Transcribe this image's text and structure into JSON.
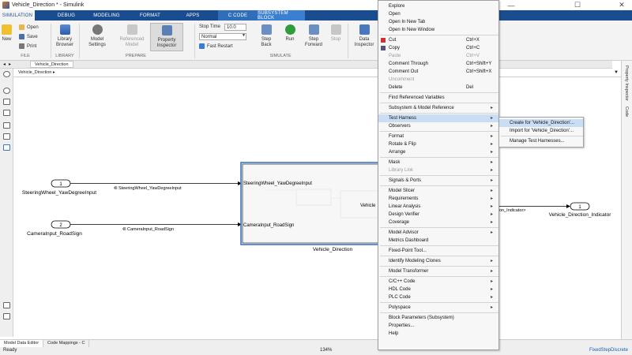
{
  "window": {
    "title": "Vehicle_Direction * - Simulink",
    "minimize": "—",
    "maximize": "☐",
    "close": "✕"
  },
  "tabs": [
    "SIMULATION",
    "DEBUG",
    "MODELING",
    "FORMAT",
    "APPS",
    "C CODE",
    "SUBSYSTEM BLOCK"
  ],
  "ribbon": {
    "new": "New",
    "open": "Open",
    "save": "Save",
    "print": "Print",
    "library_browser": "Library\nBrowser",
    "model_settings": "Model\nSettings",
    "referenced_model": "Referenced\nModel",
    "property_inspector": "Property\nInspector",
    "stop_time_label": "Stop Time",
    "stop_time_value": "10.0",
    "mode_value": "Normal",
    "fast_restart": "Fast Restart",
    "step_back": "Step\nBack",
    "run": "Run",
    "step_forward": "Step\nForward",
    "stop": "Stop",
    "data_inspector": "Data\nInspector",
    "group_file": "FILE",
    "group_library": "LIBRARY",
    "group_prepare": "PREPARE",
    "group_simulate": "SIMULATE"
  },
  "breadcrumb": {
    "tab": "Vehicle_Direction",
    "path": "Vehicle_Direction ▸"
  },
  "diagram": {
    "in1_num": "1",
    "in1_label": "SteeringWheel_YawDegreeInput",
    "sig1": "SteeringWheel_YawDegreeInput",
    "in2_num": "2",
    "in2_label": "CameraInput_RoadSign",
    "sig2": "CameraInput_RoadSign",
    "sub_port1": "SteeringWheel_YawDegreeInput",
    "sub_port2": "CameraInput_RoadSign",
    "sub_inner": "Vehicle",
    "sub_name": "Vehicle_Direction",
    "out_sig": "on_Indicator>",
    "out1_num": "1",
    "out1_label": "Vehicle_Direction_Indicator"
  },
  "right_panel": {
    "property_inspector": "Property Inspector",
    "code": "Code"
  },
  "bottom_tabs": [
    "Model Data Editor",
    "Code Mappings - C"
  ],
  "status": {
    "ready": "Ready",
    "zoom": "134%",
    "solver": "FixedStepDiscrete"
  },
  "context_menu": {
    "items": [
      {
        "label": "Explore",
        "shortcut": "",
        "arrow": false,
        "disabled": false
      },
      {
        "label": "Open",
        "shortcut": "",
        "arrow": false,
        "disabled": false
      },
      {
        "label": "Open In New Tab",
        "shortcut": "",
        "arrow": false,
        "disabled": false
      },
      {
        "label": "Open In New Window",
        "shortcut": "",
        "arrow": false,
        "disabled": false
      },
      {
        "label": "Cut",
        "shortcut": "Ctrl+X",
        "arrow": false,
        "disabled": false,
        "sep_before": true
      },
      {
        "label": "Copy",
        "shortcut": "Ctrl+C",
        "arrow": false,
        "disabled": false
      },
      {
        "label": "Paste",
        "shortcut": "Ctrl+V",
        "arrow": false,
        "disabled": true
      },
      {
        "label": "Comment Through",
        "shortcut": "Ctrl+Shift+Y",
        "arrow": false,
        "disabled": false
      },
      {
        "label": "Comment Out",
        "shortcut": "Ctrl+Shift+X",
        "arrow": false,
        "disabled": false
      },
      {
        "label": "Uncomment",
        "shortcut": "",
        "arrow": false,
        "disabled": true
      },
      {
        "label": "Delete",
        "shortcut": "Del",
        "arrow": false,
        "disabled": false
      },
      {
        "label": "Find Referenced Variables",
        "shortcut": "",
        "arrow": false,
        "disabled": false,
        "sep_before": true
      },
      {
        "label": "Subsystem & Model Reference",
        "shortcut": "",
        "arrow": true,
        "disabled": false,
        "sep_before": true
      },
      {
        "label": "Test Harness",
        "shortcut": "",
        "arrow": true,
        "disabled": false,
        "sep_before": true,
        "highlight": true
      },
      {
        "label": "Observers",
        "shortcut": "",
        "arrow": true,
        "disabled": false
      },
      {
        "label": "Format",
        "shortcut": "",
        "arrow": true,
        "disabled": false,
        "sep_before": true
      },
      {
        "label": "Rotate & Flip",
        "shortcut": "",
        "arrow": true,
        "disabled": false
      },
      {
        "label": "Arrange",
        "shortcut": "",
        "arrow": true,
        "disabled": false
      },
      {
        "label": "Mask",
        "shortcut": "",
        "arrow": true,
        "disabled": false,
        "sep_before": true
      },
      {
        "label": "Library Link",
        "shortcut": "",
        "arrow": true,
        "disabled": true
      },
      {
        "label": "Signals & Ports",
        "shortcut": "",
        "arrow": true,
        "disabled": false,
        "sep_before": true
      },
      {
        "label": "Model Slicer",
        "shortcut": "",
        "arrow": true,
        "disabled": false,
        "sep_before": true
      },
      {
        "label": "Requirements",
        "shortcut": "",
        "arrow": true,
        "disabled": false
      },
      {
        "label": "Linear Analysis",
        "shortcut": "",
        "arrow": true,
        "disabled": false
      },
      {
        "label": "Design Verifier",
        "shortcut": "",
        "arrow": true,
        "disabled": false
      },
      {
        "label": "Coverage",
        "shortcut": "",
        "arrow": true,
        "disabled": false
      },
      {
        "label": "Model Advisor",
        "shortcut": "",
        "arrow": true,
        "disabled": false,
        "sep_before": true
      },
      {
        "label": "Metrics Dashboard",
        "shortcut": "",
        "arrow": false,
        "disabled": false
      },
      {
        "label": "Fixed-Point Tool...",
        "shortcut": "",
        "arrow": false,
        "disabled": false,
        "sep_before": true
      },
      {
        "label": "Identify Modeling Clones",
        "shortcut": "",
        "arrow": true,
        "disabled": false,
        "sep_before": true
      },
      {
        "label": "Model Transformer",
        "shortcut": "",
        "arrow": true,
        "disabled": false,
        "sep_before": true
      },
      {
        "label": "C/C++ Code",
        "shortcut": "",
        "arrow": true,
        "disabled": false,
        "sep_before": true
      },
      {
        "label": "HDL Code",
        "shortcut": "",
        "arrow": true,
        "disabled": false
      },
      {
        "label": "PLC Code",
        "shortcut": "",
        "arrow": true,
        "disabled": false
      },
      {
        "label": "Polyspace",
        "shortcut": "",
        "arrow": true,
        "disabled": false,
        "sep_before": true
      },
      {
        "label": "Block Parameters (Subsystem)",
        "shortcut": "",
        "arrow": false,
        "disabled": false,
        "sep_before": true
      },
      {
        "label": "Properties...",
        "shortcut": "",
        "arrow": false,
        "disabled": false
      },
      {
        "label": "Help",
        "shortcut": "",
        "arrow": false,
        "disabled": false
      }
    ]
  },
  "submenu": {
    "items": [
      {
        "label": "Create for 'Vehicle_Direction'...",
        "highlight": true
      },
      {
        "label": "Import for 'Vehicle_Direction'..."
      },
      {
        "label": "Manage Test Harnesses...",
        "sep_before": true
      }
    ]
  },
  "colors": {
    "tab_blue": "#1a4d8f",
    "menu_highlight": "#c9def5",
    "selection_blue": "#3a78c8"
  }
}
